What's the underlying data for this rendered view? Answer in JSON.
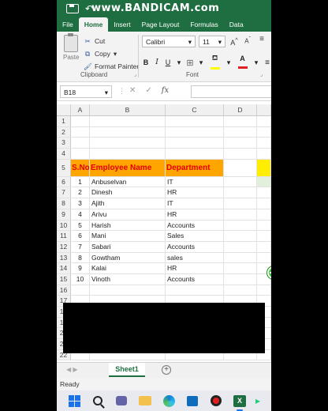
{
  "app": {
    "watermark": "www.BANDICAM.com"
  },
  "tabs": [
    {
      "label": "File"
    },
    {
      "label": "Home"
    },
    {
      "label": "Insert"
    },
    {
      "label": "Page Layout"
    },
    {
      "label": "Formulas"
    },
    {
      "label": "Data"
    }
  ],
  "ribbon": {
    "paste_label": "Paste",
    "cut_label": "Cut",
    "copy_label": "Copy",
    "format_painter_label": "Format Painter",
    "clipboard_group": "Clipboard",
    "font_name": "Calibri",
    "font_size": "11",
    "font_group": "Font",
    "bold": "B",
    "italic": "I",
    "underline": "U",
    "grow_font": "A",
    "shrink_font": "A"
  },
  "formula_bar": {
    "name_box": "B18",
    "fx": "fx"
  },
  "columns": [
    "A",
    "B",
    "C",
    "D"
  ],
  "header_row": {
    "row_num": "5",
    "sno": "S.No",
    "name": "Employee Name",
    "dept": "Department"
  },
  "empty_rows_top": [
    "1",
    "2",
    "3",
    "4"
  ],
  "rows": [
    {
      "r": "6",
      "sno": "1",
      "name": "Anbuselvan",
      "dept": "IT"
    },
    {
      "r": "7",
      "sno": "2",
      "name": "Dinesh",
      "dept": "HR"
    },
    {
      "r": "8",
      "sno": "3",
      "name": "Ajith",
      "dept": "IT"
    },
    {
      "r": "9",
      "sno": "4",
      "name": "Arivu",
      "dept": "HR"
    },
    {
      "r": "10",
      "sno": "5",
      "name": "Harish",
      "dept": "Accounts"
    },
    {
      "r": "11",
      "sno": "6",
      "name": "Mani",
      "dept": "Sales"
    },
    {
      "r": "12",
      "sno": "7",
      "name": "Sabari",
      "dept": "Accounts"
    },
    {
      "r": "13",
      "sno": "8",
      "name": "Gowtham",
      "dept": "sales"
    },
    {
      "r": "14",
      "sno": "9",
      "name": "Kalai",
      "dept": "HR"
    },
    {
      "r": "15",
      "sno": "10",
      "name": "Vinoth",
      "dept": "Accounts"
    }
  ],
  "empty_rows_bottom": [
    "16",
    "17",
    "18",
    "19",
    "20",
    "21",
    "22"
  ],
  "sheet_tab": "Sheet1",
  "status": "Ready",
  "taskbar_icons": [
    "windows-start",
    "search",
    "teams",
    "file-explorer",
    "edge",
    "store",
    "bandicam-record",
    "excel"
  ]
}
